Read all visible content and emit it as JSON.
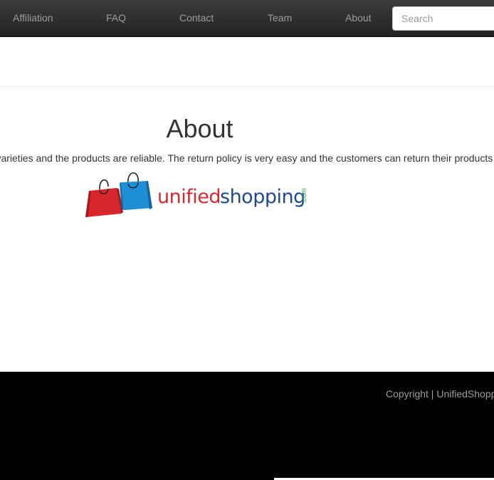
{
  "navbar": {
    "links": [
      "Affiliation",
      "FAQ",
      "Contact",
      "Team",
      "About"
    ],
    "search": {
      "placeholder": "Search",
      "value": ""
    }
  },
  "about": {
    "title": "About",
    "text": "y of varieties and the products are reliable. The return policy is very easy and the customers can return their products"
  },
  "logo": {
    "word1": "unified",
    "word2": "shopping",
    "suffix": ".com",
    "colors": {
      "red": "#d42a34",
      "blue": "#1c4a8c",
      "green": "#3aa948"
    },
    "icons": [
      "red-shopping-bag-icon",
      "blue-shopping-bag-icon"
    ]
  },
  "footer": {
    "copyright": "Copyright | UnifiedShopping"
  },
  "colors": {
    "navbar_bg": "#222222",
    "nav_text": "#9d9d9d",
    "footer_bg": "#000000"
  }
}
